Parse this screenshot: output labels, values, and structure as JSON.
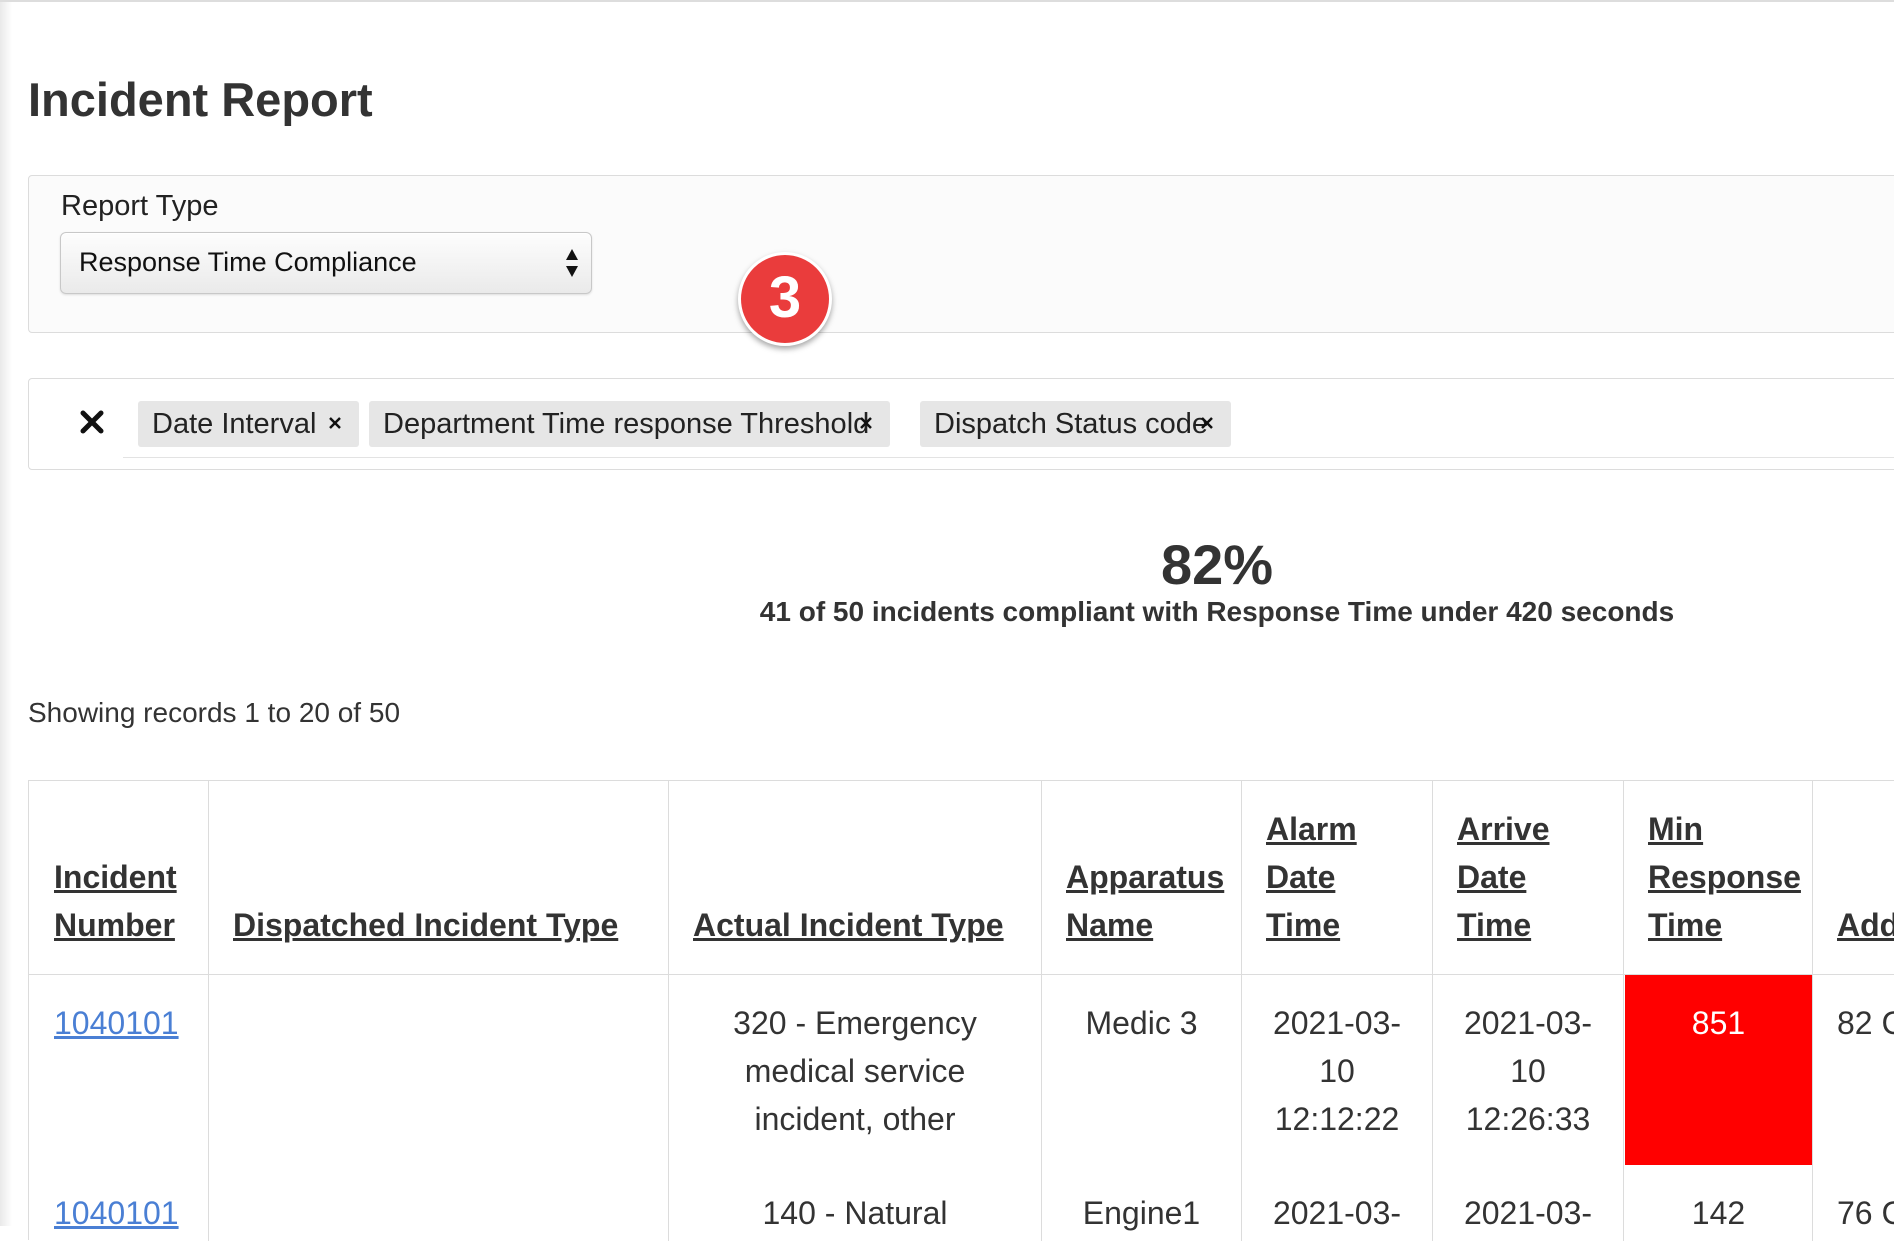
{
  "page": {
    "title": "Incident Report"
  },
  "report_type": {
    "label": "Report Type",
    "selected": "Response Time Compliance"
  },
  "step_badge": {
    "number": "3",
    "color": "#ea3c3c"
  },
  "filters": {
    "chips": [
      "Date Interval",
      "Department Time response Threshold",
      "Dispatch Status code"
    ]
  },
  "summary": {
    "percent": "82%",
    "text": "41 of 50 incidents compliant with Response Time under 420 seconds"
  },
  "records_info": "Showing records 1 to 20 of 50",
  "table": {
    "columns": [
      [
        "Incident",
        "Number"
      ],
      [
        "Dispatched Incident Type"
      ],
      [
        "Actual Incident Type"
      ],
      [
        "Apparatus",
        "Name"
      ],
      [
        "Alarm",
        "Date",
        "Time"
      ],
      [
        "Arrive",
        "Date",
        "Time"
      ],
      [
        "Min",
        "Response",
        "Time"
      ],
      [
        "Add"
      ]
    ],
    "rows": [
      {
        "incident_number": "1040101",
        "dispatched_type": "",
        "actual_type": [
          "320 - Emergency",
          "medical service",
          "incident, other"
        ],
        "apparatus": "Medic 3",
        "alarm": [
          "2021-03-",
          "10",
          "12:12:22"
        ],
        "arrive": [
          "2021-03-",
          "10",
          "12:26:33"
        ],
        "min_response": "851",
        "address": "82 C"
      },
      {
        "incident_number": "1040101",
        "dispatched_type": "",
        "actual_type": [
          "140 - Natural"
        ],
        "apparatus": "Engine1",
        "alarm": [
          "2021-03-"
        ],
        "arrive": [
          "2021-03-"
        ],
        "min_response": "142",
        "address": "76 C"
      }
    ]
  },
  "colors": {
    "alert": "#ff0000",
    "link": "#4a7fd4"
  }
}
